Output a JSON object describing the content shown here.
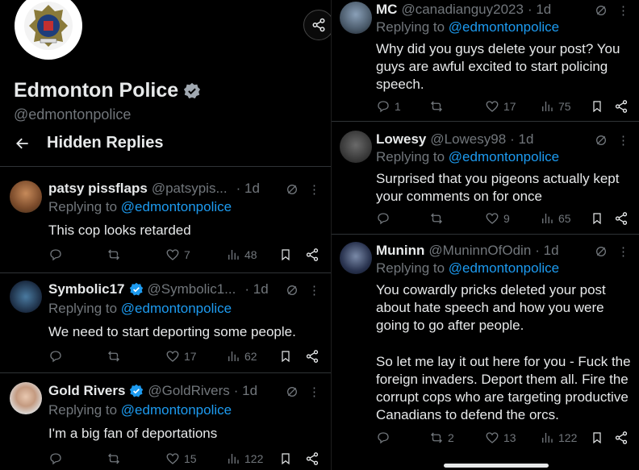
{
  "profile": {
    "name": "Edmonton Police",
    "handle": "@edmontonpolice",
    "section_title": "Hidden Replies"
  },
  "colors": {
    "accent": "#1d9bf0",
    "muted": "#71767b",
    "text": "#e7e9ea",
    "bg": "#000000"
  },
  "left_replies": [
    {
      "name": "patsy pissflaps",
      "handle": "@patsypis...",
      "time": "· 1d",
      "verified": false,
      "replying_prefix": "Replying to",
      "replying_to": "@edmontonpolice",
      "text": "This cop looks retarded",
      "replies": "",
      "reposts": "",
      "likes": "7",
      "views": "48"
    },
    {
      "name": "Symbolic17",
      "handle": "@Symbolic1...",
      "time": "· 1d",
      "verified": true,
      "replying_prefix": "Replying to",
      "replying_to": "@edmontonpolice",
      "text": "We need to start deporting some people.",
      "replies": "",
      "reposts": "",
      "likes": "17",
      "views": "62"
    },
    {
      "name": "Gold Rivers",
      "handle": "@GoldRivers",
      "time": "· 1d",
      "verified": true,
      "replying_prefix": "Replying to",
      "replying_to": "@edmontonpolice",
      "text": "I'm a big fan of deportations",
      "replies": "",
      "reposts": "",
      "likes": "15",
      "views": "122"
    }
  ],
  "right_replies": [
    {
      "name": "MC",
      "handle": "@canadianguy2023",
      "time": "· 1d",
      "replying_prefix": "Replying to",
      "replying_to": "@edmontonpolice",
      "text": "Why did you guys delete your post? You guys are awful excited to start policing speech.",
      "replies": "1",
      "reposts": "",
      "likes": "17",
      "views": "75"
    },
    {
      "name": "Lowesy",
      "handle": "@Lowesy98",
      "time": "· 1d",
      "replying_prefix": "Replying to",
      "replying_to": "@edmontonpolice",
      "text": "Surprised that you pigeons actually kept your comments on for once",
      "replies": "",
      "reposts": "",
      "likes": "9",
      "views": "65"
    },
    {
      "name": "Muninn",
      "handle": "@MuninnOfOdin",
      "time": "· 1d",
      "replying_prefix": "Replying to",
      "replying_to": "@edmontonpolice",
      "text": "You cowardly pricks deleted your post about hate speech and how you were going to go after people.",
      "text2": "So let me lay it out here for you - Fuck the foreign invaders. Deport them all. Fire the corrupt cops who are targeting productive Canadians to defend the orcs.",
      "replies": "",
      "reposts": "2",
      "likes": "13",
      "views": "122"
    }
  ]
}
